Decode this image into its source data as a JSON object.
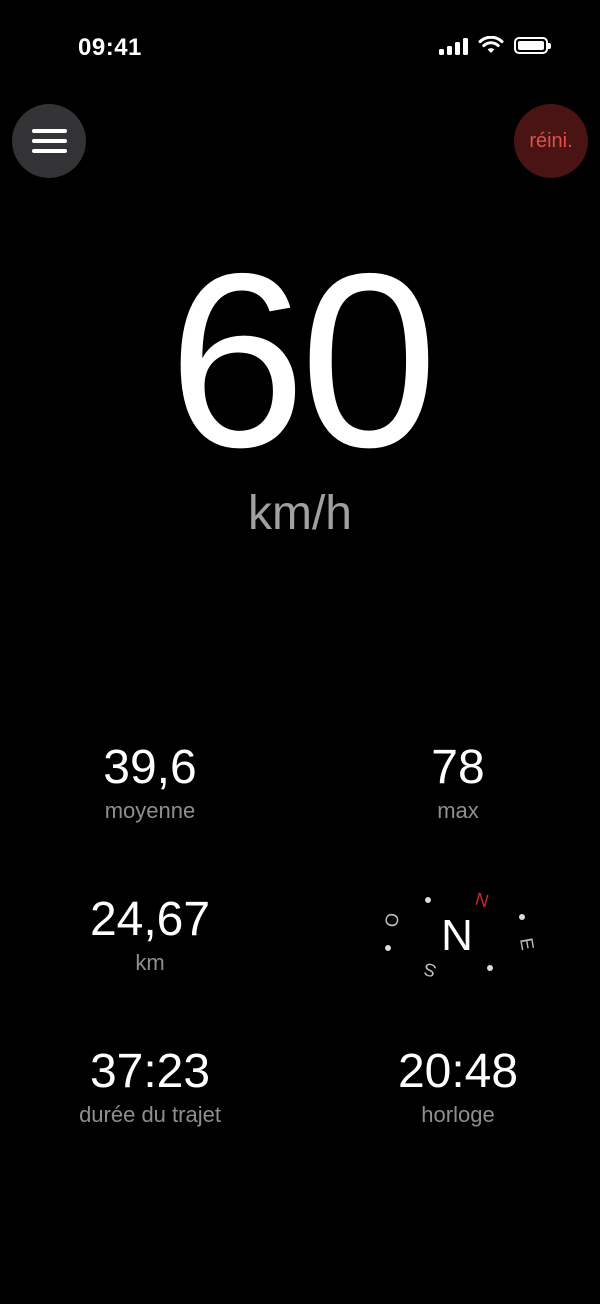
{
  "status_bar": {
    "time": "09:41",
    "icons": [
      "cellular-signal-icon",
      "wifi-icon",
      "battery-icon"
    ]
  },
  "top_bar": {
    "menu_icon": "hamburger-menu-icon",
    "reset_label": "réini."
  },
  "speed": {
    "value": "60",
    "unit": "km/h"
  },
  "stats": {
    "average": {
      "value": "39,6",
      "label": "moyenne"
    },
    "max": {
      "value": "78",
      "label": "max"
    },
    "distance": {
      "value": "24,67",
      "label": "km"
    },
    "duration": {
      "value": "37:23",
      "label": "durée du trajet"
    },
    "clock": {
      "value": "20:48",
      "label": "horloge"
    }
  },
  "compass": {
    "heading": "N",
    "marker": "N",
    "east": "E",
    "south": "S",
    "west": "O"
  },
  "colors": {
    "background": "#000000",
    "menu_button": "#333335",
    "reset_button_bg": "#4a1414",
    "reset_text": "#e0504a",
    "label": "#8e8e93",
    "compass_marker": "#c0282a"
  }
}
